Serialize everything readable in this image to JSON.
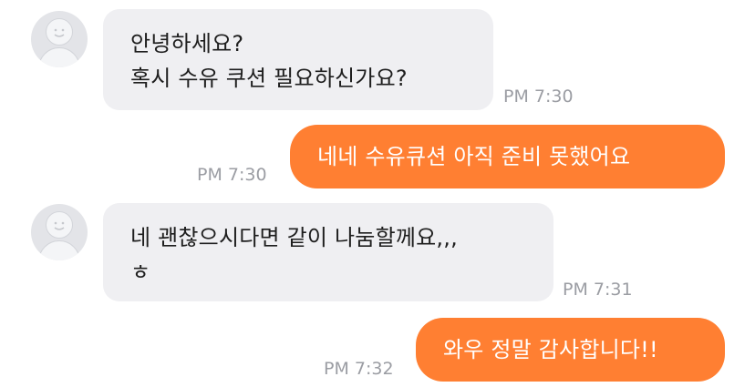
{
  "messages": [
    {
      "direction": "incoming",
      "lines": [
        "안녕하세요?",
        "혹시 수유 쿠션 필요하신가요?"
      ],
      "time": "PM 7:30"
    },
    {
      "direction": "outgoing",
      "lines": [
        "네네 수유큐션 아직 준비 못했어요"
      ],
      "time": "PM 7:30"
    },
    {
      "direction": "incoming",
      "lines": [
        "네 괜찮으시다면 같이 나눔할께요,,,",
        "ㅎ"
      ],
      "time": "PM 7:31"
    },
    {
      "direction": "outgoing",
      "lines": [
        "와우 정말 감사합니다!!"
      ],
      "time": "PM 7:32"
    }
  ],
  "colors": {
    "incoming_bubble": "#efeff2",
    "outgoing_bubble": "#ff7f32",
    "timestamp": "#9b9da3",
    "avatar_bg": "#e3e4e8"
  },
  "icons": {
    "avatar": "default-user-avatar-icon"
  }
}
